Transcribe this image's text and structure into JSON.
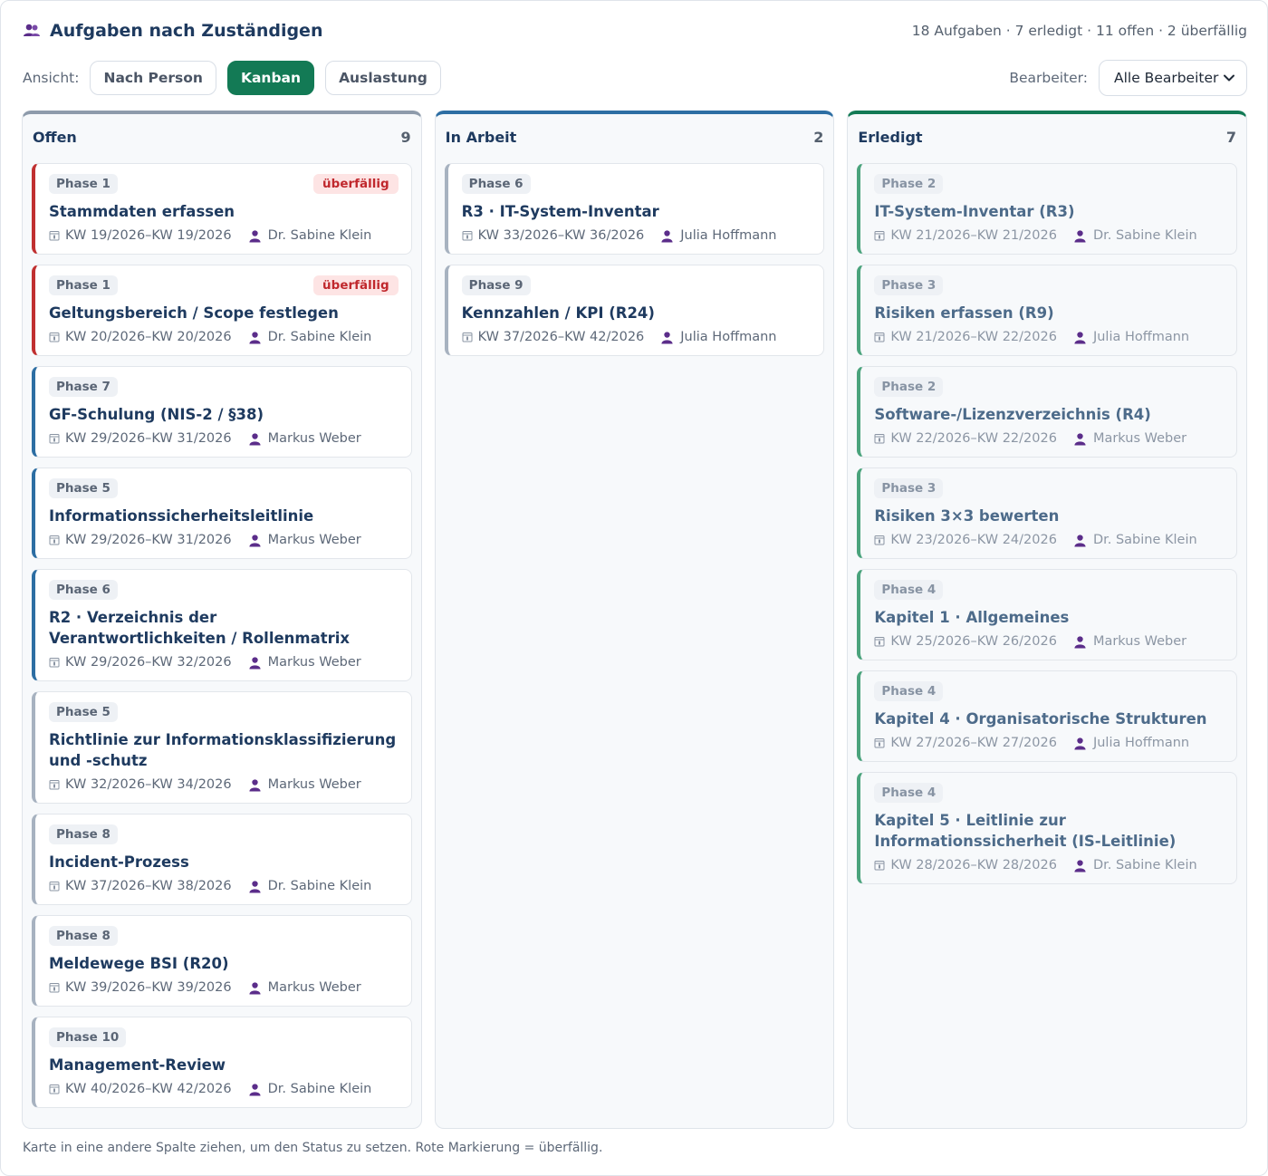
{
  "header": {
    "title": "Aufgaben nach Zuständigen",
    "summary": "18 Aufgaben · 7 erledigt · 11 offen · 2 überfällig"
  },
  "toolbar": {
    "view_label": "Ansicht:",
    "views": [
      "Nach Person",
      "Kanban",
      "Auslastung"
    ],
    "active_view": "Kanban",
    "assignee_label": "Bearbeiter:",
    "assignee_value": "Alle Bearbeiter"
  },
  "columns": [
    {
      "title": "Offen",
      "count": "9",
      "cards": [
        {
          "phase": "Phase 1",
          "badge": "überfällig",
          "title": "Stammdaten erfassen",
          "weeks": "KW 19/2026–KW 19/2026",
          "person": "Dr. Sabine Klein"
        },
        {
          "phase": "Phase 1",
          "badge": "überfällig",
          "title": "Geltungsbereich / Scope festlegen",
          "weeks": "KW 20/2026–KW 20/2026",
          "person": "Dr. Sabine Klein"
        },
        {
          "phase": "Phase 7",
          "title": "GF-Schulung (NIS-2 / §38)",
          "weeks": "KW 29/2026–KW 31/2026",
          "person": "Markus Weber"
        },
        {
          "phase": "Phase 5",
          "title": "Informationssicherheitsleitlinie",
          "weeks": "KW 29/2026–KW 31/2026",
          "person": "Markus Weber"
        },
        {
          "phase": "Phase 6",
          "title": "R2 · Verzeichnis der Verantwortlichkeiten / Rollenmatrix",
          "weeks": "KW 29/2026–KW 32/2026",
          "person": "Markus Weber"
        },
        {
          "phase": "Phase 5",
          "title": "Richtlinie zur Informationsklassifizierung und -schutz",
          "weeks": "KW 32/2026–KW 34/2026",
          "person": "Markus Weber"
        },
        {
          "phase": "Phase 8",
          "title": "Incident-Prozess",
          "weeks": "KW 37/2026–KW 38/2026",
          "person": "Dr. Sabine Klein"
        },
        {
          "phase": "Phase 8",
          "title": "Meldewege BSI (R20)",
          "weeks": "KW 39/2026–KW 39/2026",
          "person": "Markus Weber"
        },
        {
          "phase": "Phase 10",
          "title": "Management-Review",
          "weeks": "KW 40/2026–KW 42/2026",
          "person": "Dr. Sabine Klein"
        }
      ]
    },
    {
      "title": "In Arbeit",
      "count": "2",
      "cards": [
        {
          "phase": "Phase 6",
          "title": "R3 · IT-System-Inventar",
          "weeks": "KW 33/2026–KW 36/2026",
          "person": "Julia Hoffmann"
        },
        {
          "phase": "Phase 9",
          "title": "Kennzahlen / KPI (R24)",
          "weeks": "KW 37/2026–KW 42/2026",
          "person": "Julia Hoffmann"
        }
      ]
    },
    {
      "title": "Erledigt",
      "count": "7",
      "cards": [
        {
          "phase": "Phase 2",
          "title": "IT-System-Inventar (R3)",
          "weeks": "KW 21/2026–KW 21/2026",
          "person": "Dr. Sabine Klein"
        },
        {
          "phase": "Phase 3",
          "title": "Risiken erfassen (R9)",
          "weeks": "KW 21/2026–KW 22/2026",
          "person": "Julia Hoffmann"
        },
        {
          "phase": "Phase 2",
          "title": "Software-/Lizenzverzeichnis (R4)",
          "weeks": "KW 22/2026–KW 22/2026",
          "person": "Markus Weber"
        },
        {
          "phase": "Phase 3",
          "title": "Risiken 3×3 bewerten",
          "weeks": "KW 23/2026–KW 24/2026",
          "person": "Dr. Sabine Klein"
        },
        {
          "phase": "Phase 4",
          "title": "Kapitel 1 · Allgemeines",
          "weeks": "KW 25/2026–KW 26/2026",
          "person": "Markus Weber"
        },
        {
          "phase": "Phase 4",
          "title": "Kapitel 4 · Organisatorische Strukturen",
          "weeks": "KW 27/2026–KW 27/2026",
          "person": "Julia Hoffmann"
        },
        {
          "phase": "Phase 4",
          "title": "Kapitel 5 · Leitlinie zur Informationssicherheit (IS-Leitlinie)",
          "weeks": "KW 28/2026–KW 28/2026",
          "person": "Dr. Sabine Klein"
        }
      ]
    }
  ],
  "footer": "Karte in eine andere Spalte ziehen, um den Status zu setzen. Rote Markierung = überfällig.",
  "colors": {
    "accent": "#137a55",
    "overdue": "#c03030",
    "in_progress": "#2d6ea3",
    "open": "#8e9bab",
    "person_icon": "#5b2d8a"
  }
}
